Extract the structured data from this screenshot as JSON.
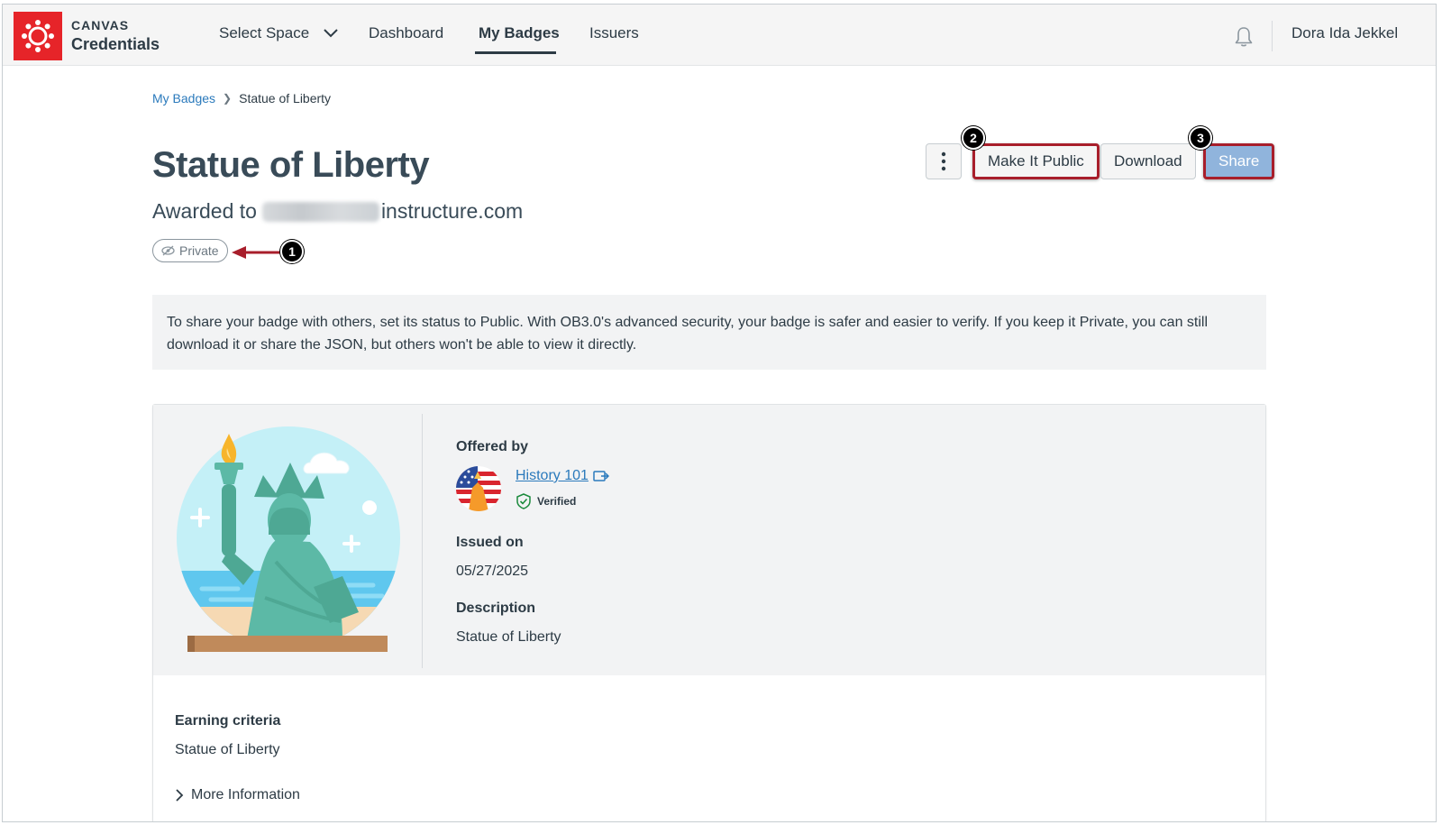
{
  "header": {
    "logo_top": "CANVAS",
    "logo_bottom": "Credentials",
    "nav": {
      "select_space": "Select Space",
      "dashboard": "Dashboard",
      "my_badges": "My Badges",
      "issuers": "Issuers"
    },
    "user_name": "Dora Ida Jekkel"
  },
  "breadcrumb": {
    "parent": "My Badges",
    "current": "Statue of Liberty"
  },
  "badge": {
    "title": "Statue of Liberty",
    "awarded_prefix": "Awarded to",
    "awarded_suffix": "instructure.com",
    "visibility": "Private"
  },
  "actions": {
    "make_public": "Make It Public",
    "download": "Download",
    "share": "Share"
  },
  "annotations": [
    "1",
    "2",
    "3"
  ],
  "info_text": "To share your badge with others, set its status to Public. With OB3.0's advanced security, your badge is safer and easier to verify. If you keep it Private, you can still download it or share the JSON, but others won't be able to view it directly.",
  "details": {
    "offered_by_label": "Offered by",
    "issuer_name": "History 101",
    "verified_label": "Verified",
    "issued_on_label": "Issued on",
    "issued_on_value": "05/27/2025",
    "description_label": "Description",
    "description_value": "Statue of Liberty"
  },
  "criteria": {
    "label": "Earning criteria",
    "value": "Statue of Liberty",
    "more_info": "More Information"
  },
  "colors": {
    "brand_red": "#e62429",
    "annotation_border": "#a81e2b",
    "link_blue": "#2b7abc",
    "share_button": "#90b4dc"
  }
}
